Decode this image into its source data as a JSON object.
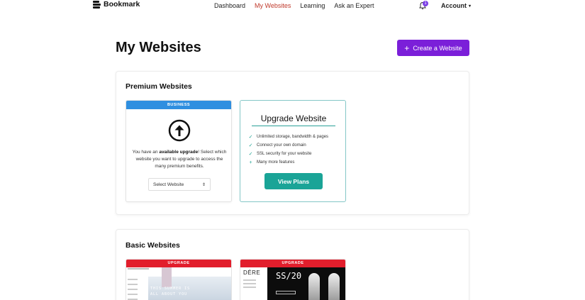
{
  "nav": {
    "brand": "Bookmark",
    "links": [
      "Dashboard",
      "My Websites",
      "Learning",
      "Ask an Expert"
    ],
    "notification_count": "1",
    "account_label": "Account"
  },
  "page": {
    "title": "My Websites",
    "create_button": "Create a Website"
  },
  "premium": {
    "title": "Premium Websites",
    "business_card": {
      "band": "BUSINESS",
      "text_before": "You have an ",
      "text_bold": "available upgrade",
      "text_after": "! Select which website you want to upgrade to access the many premium benefits.",
      "select_value": "Select Website"
    },
    "upgrade_card": {
      "title": "Upgrade Website",
      "features": [
        "Unlimited storage, bandwidth & pages",
        "Connect your own domain",
        "SSL security for your website",
        "Many more features"
      ],
      "button": "View Plans"
    }
  },
  "basic": {
    "title": "Basic Websites",
    "sites": [
      {
        "band": "UPGRADE",
        "hero_text": "THIS SUMMER IS ALL ABOUT YOU"
      },
      {
        "band": "UPGRADE",
        "brand": "DÉRE",
        "hero_text": "SS/20"
      }
    ]
  },
  "colors": {
    "accent_purple": "#7b1fd9",
    "active_link": "#c0392b",
    "teal": "#1aa497",
    "business_blue": "#2f8fe0",
    "upgrade_red": "#e21e2c"
  }
}
